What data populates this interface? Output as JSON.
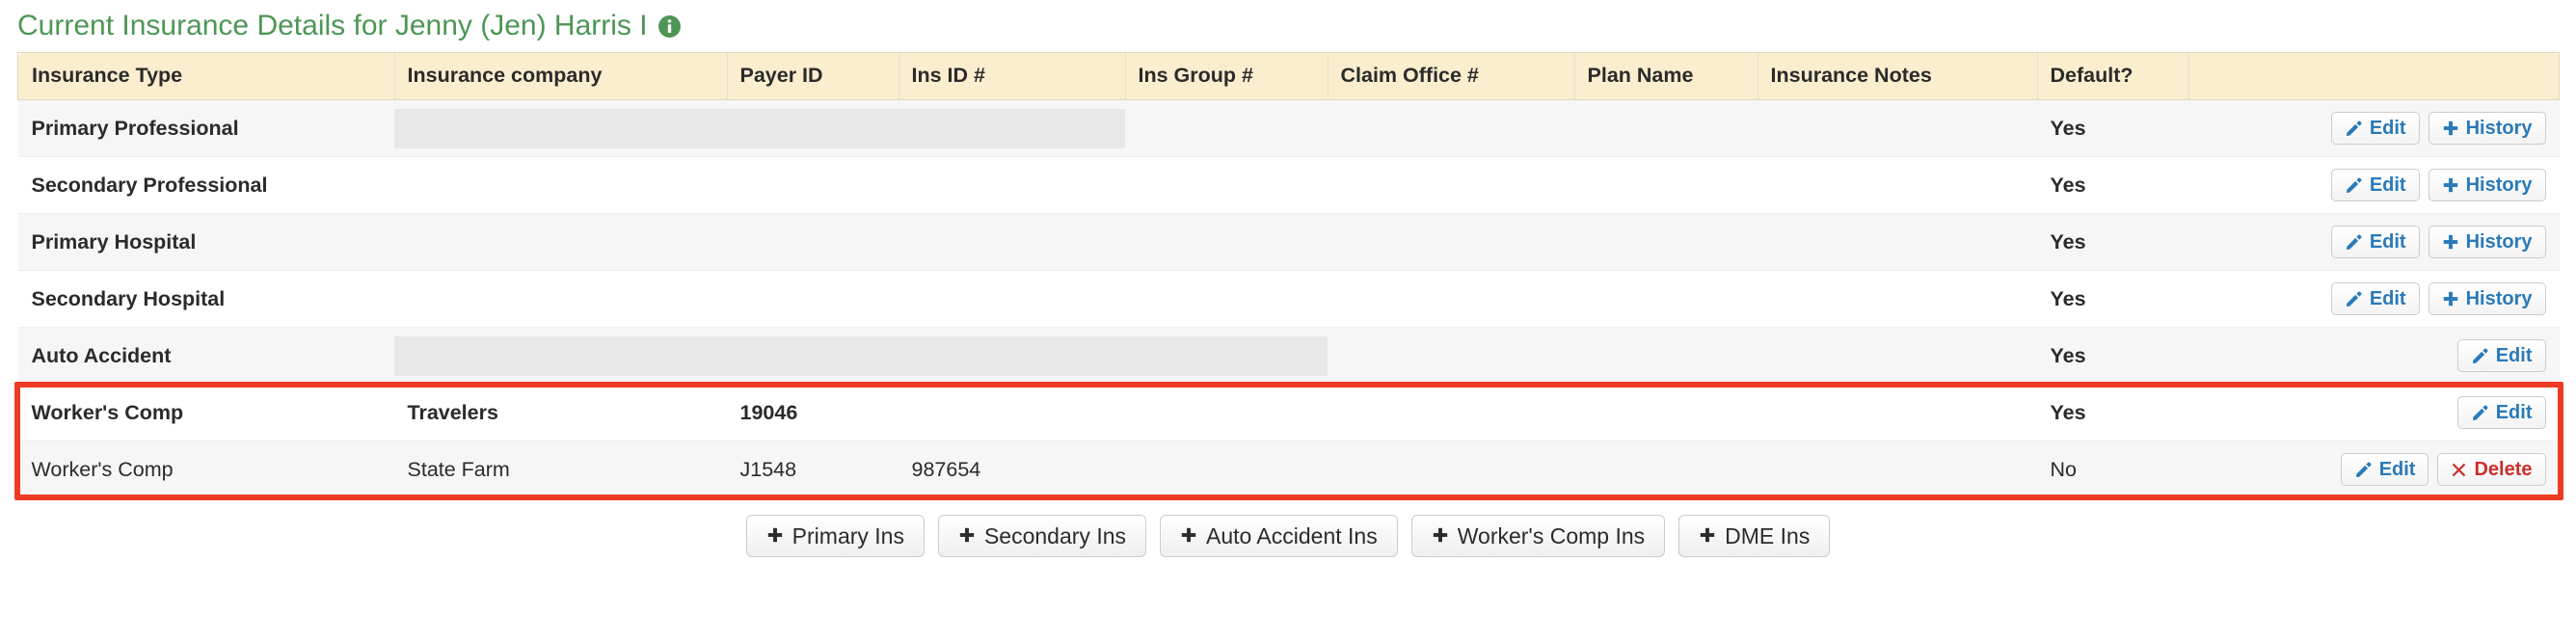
{
  "header": {
    "title": "Current Insurance Details for Jenny (Jen) Harris I",
    "info_icon": "info-circle-icon",
    "title_color": "#4d9655"
  },
  "table": {
    "columns": [
      "Insurance Type",
      "Insurance company",
      "Payer ID",
      "Ins ID #",
      "Ins Group #",
      "Claim Office #",
      "Plan Name",
      "Insurance Notes",
      "Default?",
      ""
    ],
    "rows": [
      {
        "insurance_type": "Primary Professional",
        "insurance_company": "",
        "payer_id": "",
        "ins_id": "",
        "ins_group": "",
        "claim_office": "",
        "plan_name": "",
        "insurance_notes": "",
        "default": "Yes",
        "placeholder": true,
        "bold": true,
        "actions": [
          "Edit",
          "History"
        ]
      },
      {
        "insurance_type": "Secondary Professional",
        "insurance_company": "",
        "payer_id": "",
        "ins_id": "",
        "ins_group": "",
        "claim_office": "",
        "plan_name": "",
        "insurance_notes": "",
        "default": "Yes",
        "placeholder": false,
        "bold": true,
        "actions": [
          "Edit",
          "History"
        ]
      },
      {
        "insurance_type": "Primary Hospital",
        "insurance_company": "",
        "payer_id": "",
        "ins_id": "",
        "ins_group": "",
        "claim_office": "",
        "plan_name": "",
        "insurance_notes": "",
        "default": "Yes",
        "placeholder": false,
        "bold": true,
        "actions": [
          "Edit",
          "History"
        ]
      },
      {
        "insurance_type": "Secondary Hospital",
        "insurance_company": "",
        "payer_id": "",
        "ins_id": "",
        "ins_group": "",
        "claim_office": "",
        "plan_name": "",
        "insurance_notes": "",
        "default": "Yes",
        "placeholder": false,
        "bold": true,
        "actions": [
          "Edit",
          "History"
        ]
      },
      {
        "insurance_type": "Auto Accident",
        "insurance_company": "",
        "payer_id": "",
        "ins_id": "",
        "ins_group": "",
        "claim_office": "",
        "plan_name": "",
        "insurance_notes": "",
        "default": "Yes",
        "placeholder": true,
        "bold": true,
        "actions": [
          "Edit"
        ]
      },
      {
        "insurance_type": "Worker's Comp",
        "insurance_company": "Travelers",
        "payer_id": "19046",
        "ins_id": "",
        "ins_group": "",
        "claim_office": "",
        "plan_name": "",
        "insurance_notes": "",
        "default": "Yes",
        "placeholder": false,
        "bold": true,
        "actions": [
          "Edit"
        ]
      },
      {
        "insurance_type": "Worker's Comp",
        "insurance_company": "State Farm",
        "payer_id": "J1548",
        "ins_id": "987654",
        "ins_group": "",
        "claim_office": "",
        "plan_name": "",
        "insurance_notes": "",
        "default": "No",
        "placeholder": false,
        "bold": false,
        "actions": [
          "Edit",
          "Delete"
        ]
      }
    ],
    "action_labels": {
      "edit": "Edit",
      "history": "History",
      "delete": "Delete"
    },
    "action_icons": {
      "edit": "pencil-icon",
      "history": "plus-icon",
      "delete": "x-icon"
    },
    "highlight_color": "#ee3b24",
    "header_bg": "#fbeecf"
  },
  "footer": {
    "buttons": [
      {
        "label": "Primary Ins",
        "icon": "plus-icon"
      },
      {
        "label": "Secondary Ins",
        "icon": "plus-icon"
      },
      {
        "label": "Auto Accident Ins",
        "icon": "plus-icon"
      },
      {
        "label": "Worker's Comp Ins",
        "icon": "plus-icon"
      },
      {
        "label": "DME Ins",
        "icon": "plus-icon"
      }
    ]
  }
}
